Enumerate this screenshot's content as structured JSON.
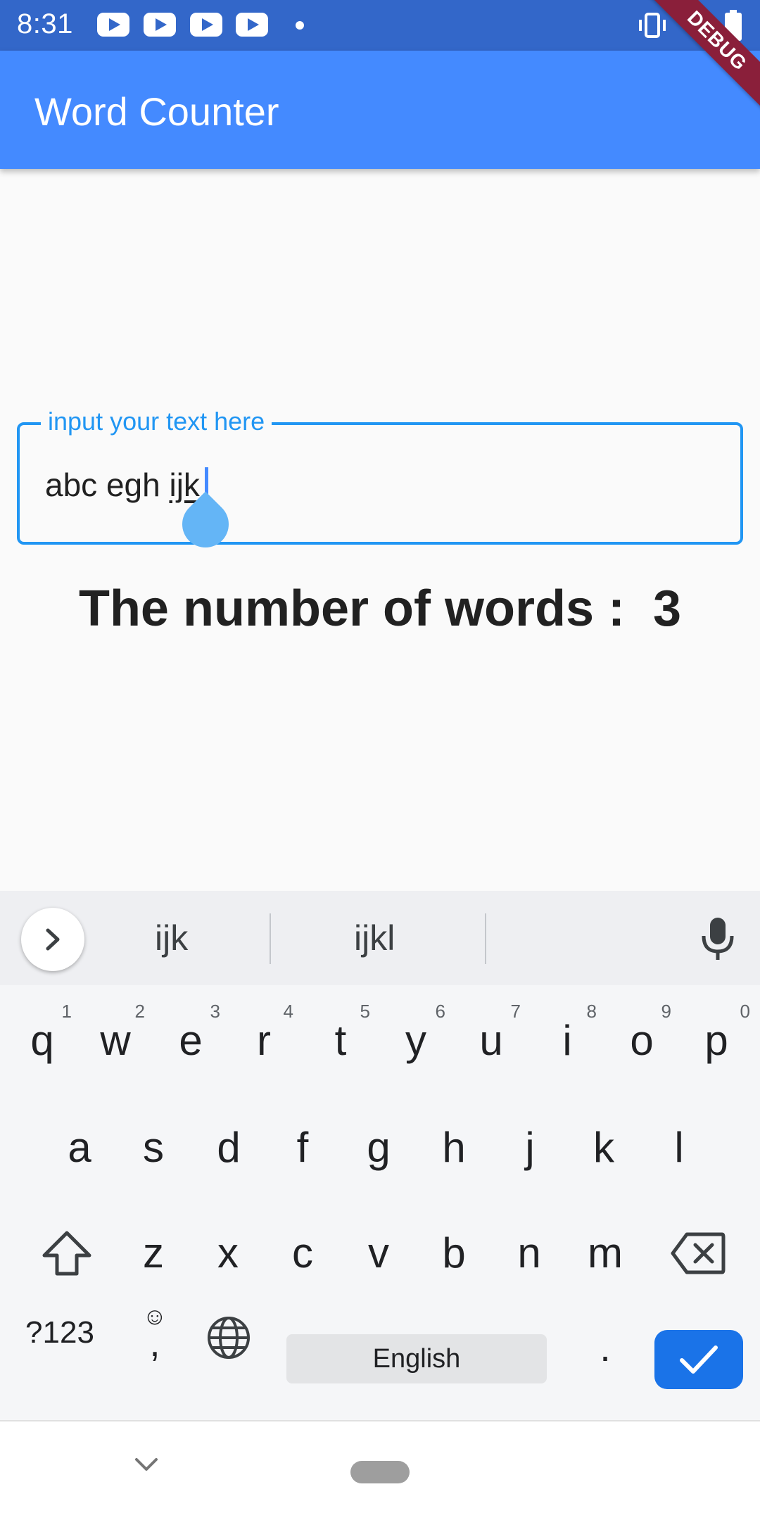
{
  "status_bar": {
    "time": "8:31",
    "notification_icons": [
      "youtube-icon",
      "youtube-icon",
      "youtube-icon",
      "youtube-icon",
      "more-dot-icon"
    ],
    "right_icons": [
      "vibrate-icon",
      "wifi-icon",
      "battery-icon"
    ]
  },
  "debug_banner": "DEBUG",
  "app_bar": {
    "title": "Word Counter",
    "color": "#448aff"
  },
  "text_field": {
    "label": "input your text here",
    "value_prefix": "abc egh ",
    "value_composing": "ijk",
    "accent": "#2196f3"
  },
  "result": {
    "text": "The number of words :  3"
  },
  "keyboard": {
    "suggestions": [
      "ijk",
      "ijkl",
      ""
    ],
    "row1": [
      {
        "key": "q",
        "hint": "1"
      },
      {
        "key": "w",
        "hint": "2"
      },
      {
        "key": "e",
        "hint": "3"
      },
      {
        "key": "r",
        "hint": "4"
      },
      {
        "key": "t",
        "hint": "5"
      },
      {
        "key": "y",
        "hint": "6"
      },
      {
        "key": "u",
        "hint": "7"
      },
      {
        "key": "i",
        "hint": "8"
      },
      {
        "key": "o",
        "hint": "9"
      },
      {
        "key": "p",
        "hint": "0"
      }
    ],
    "row2": [
      "a",
      "s",
      "d",
      "f",
      "g",
      "h",
      "j",
      "k",
      "l"
    ],
    "row3": [
      "z",
      "x",
      "c",
      "v",
      "b",
      "n",
      "m"
    ],
    "symbols_label": "?123",
    "emoji_comma": {
      "emoji": "☺",
      "comma": ","
    },
    "space_label": "English",
    "period_label": ".",
    "enter_color": "#1a73e8"
  },
  "nav_bar": {
    "icons": [
      "back-chevron-icon",
      "home-pill-icon"
    ]
  }
}
